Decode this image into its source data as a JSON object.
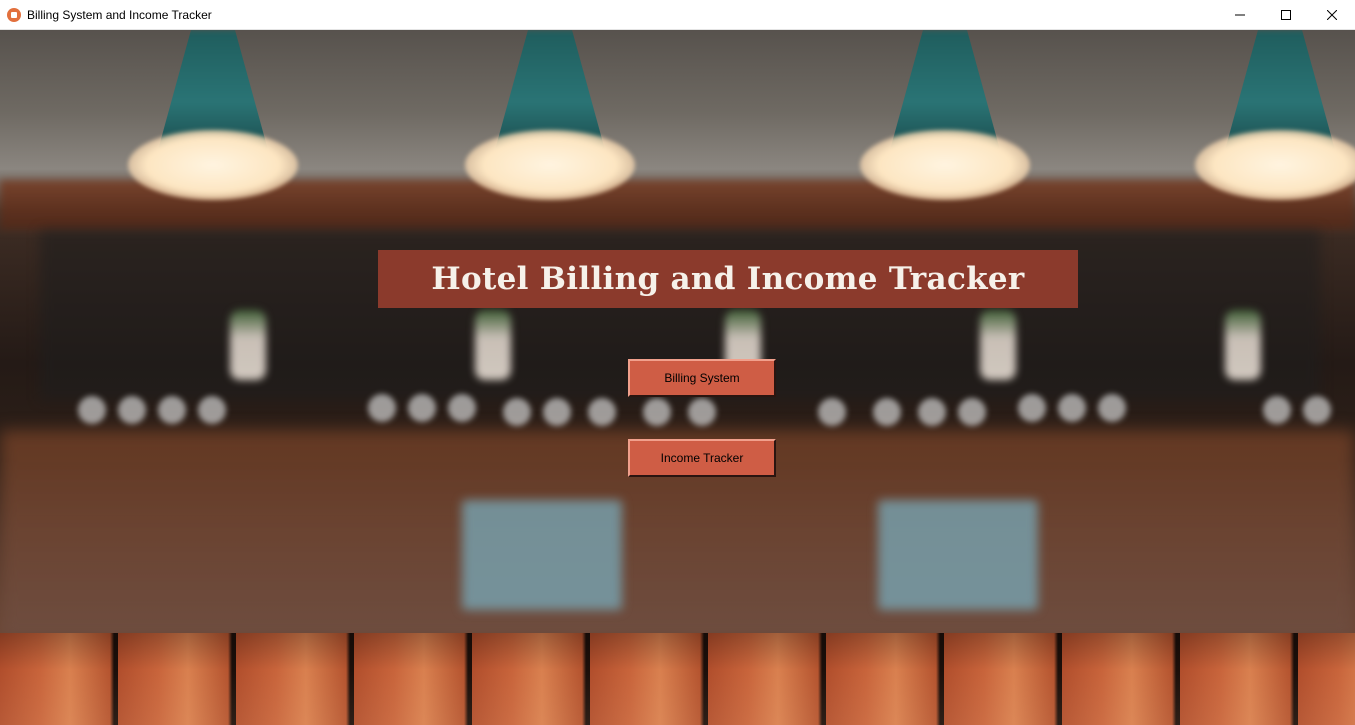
{
  "window": {
    "title": "Billing System and Income Tracker",
    "controls": {
      "minimize": "minimize-icon",
      "maximize": "maximize-icon",
      "close": "close-icon"
    }
  },
  "main": {
    "heading": "Hotel Billing and Income Tracker",
    "buttons": {
      "billing": "Billing System",
      "income": "Income Tracker"
    }
  },
  "colors": {
    "banner": "#8b3a2c",
    "button": "#cf5d45",
    "heading_text": "#f6f1ea"
  }
}
